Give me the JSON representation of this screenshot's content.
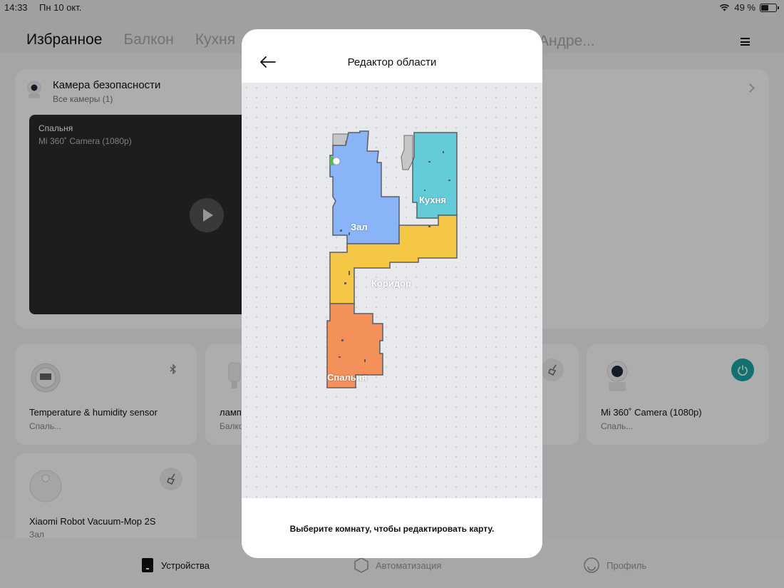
{
  "status_bar": {
    "time": "14:33",
    "date": "Пн 10 окт.",
    "battery_text": "49 %",
    "battery_level": 0.49
  },
  "tabs": [
    {
      "label": "Избранное",
      "active": true
    },
    {
      "label": "Балкон",
      "active": false
    },
    {
      "label": "Кухня",
      "active": false
    }
  ],
  "tab_right": "Андре...",
  "camera_card": {
    "title": "Камера безопасности",
    "subtitle": "Все камеры (1)",
    "video_room": "Спальня",
    "video_model": "Mi 360˚ Camera (1080p)"
  },
  "devices": [
    {
      "name": "Temperature & humidity sensor",
      "room": "Спаль...",
      "icon": "thermometer-icon",
      "action_icon": "bluetooth-icon"
    },
    {
      "name": "ламп",
      "room": "Балко",
      "icon": "lamp-icon"
    },
    {
      "name": "Mi 360˚ Camera (1080p)",
      "room": "Спаль...",
      "icon": "camera-icon",
      "action_icon": "power-icon"
    },
    {
      "name": "Xiaomi Robot Vacuum-Mop 2S",
      "room": "Зал",
      "icon": "robot-vacuum-icon",
      "action_icon": "broom-icon"
    }
  ],
  "bottom_nav": [
    {
      "label": "Устройства",
      "active": true
    },
    {
      "label": "Автоматизация",
      "active": false
    },
    {
      "label": "Профиль",
      "active": false
    }
  ],
  "modal": {
    "title": "Редактор области",
    "hint": "Выберите комнату, чтобы редактировать карту.",
    "rooms": [
      {
        "name": "Зал",
        "color": "#8ab4f8"
      },
      {
        "name": "Кухня",
        "color": "#64cbd9"
      },
      {
        "name": "Коридор",
        "color": "#f4c845"
      },
      {
        "name": "Спальня",
        "color": "#f4905a"
      }
    ]
  },
  "colors": {
    "accent_teal": "#1aa5a5",
    "overlay": "rgba(0,0,0,0.32)"
  }
}
